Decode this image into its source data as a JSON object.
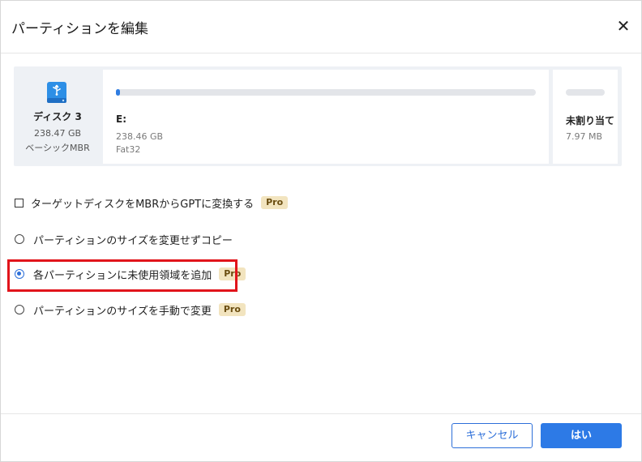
{
  "dialog": {
    "title": "パーティションを編集",
    "close_label": "✕"
  },
  "disk": {
    "icon": "usb-drive-icon",
    "name": "ディスク 3",
    "size": "238.47 GB",
    "type": "ベーシックMBR",
    "partitions": [
      {
        "label": "E:",
        "size": "238.46 GB",
        "filesystem": "Fat32",
        "used_fraction": 0.01
      },
      {
        "label": "未割り当て",
        "size": "7.97 MB"
      }
    ]
  },
  "options": {
    "convert_label": "ターゲットディスクをMBRからGPTに変換する",
    "no_resize_label": "パーティションのサイズを変更せずコピー",
    "add_unused_label": "各パーティションに未使用領域を追加",
    "manual_resize_label": "パーティションのサイズを手動で変更",
    "pro_badge": "Pro",
    "selected": "add_unused"
  },
  "buttons": {
    "cancel": "キャンセル",
    "ok": "はい"
  },
  "colors": {
    "accent": "#2d7ae6",
    "highlight": "#e1141b",
    "pro_badge_bg": "#f2e4bf"
  }
}
